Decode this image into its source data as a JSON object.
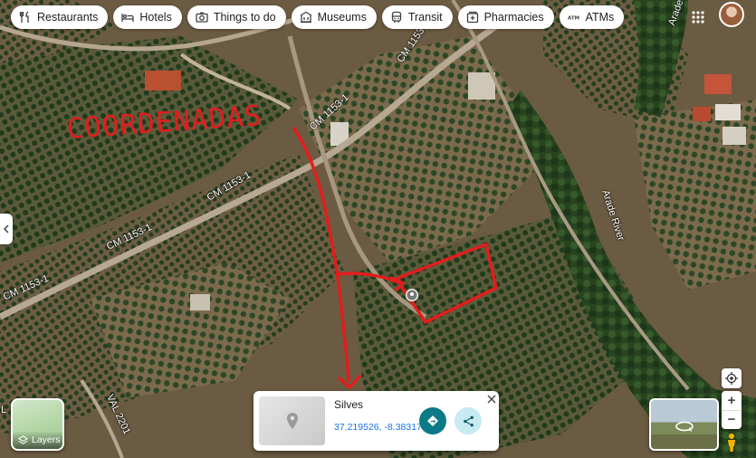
{
  "chips": [
    {
      "icon": "restaurant-icon",
      "label": "Restaurants"
    },
    {
      "icon": "hotel-icon",
      "label": "Hotels"
    },
    {
      "icon": "camera-icon",
      "label": "Things to do"
    },
    {
      "icon": "museum-icon",
      "label": "Museums"
    },
    {
      "icon": "transit-icon",
      "label": "Transit"
    },
    {
      "icon": "pharmacy-icon",
      "label": "Pharmacies"
    },
    {
      "icon": "atm-icon",
      "label": "ATMs"
    }
  ],
  "map_labels": {
    "road_1": "CM 1153-1",
    "road_2": "CM 1153-1",
    "road_3": "CM 1153-1",
    "road_4": "CM 1153-1",
    "road_5": "CM 1153",
    "river": "Arade River",
    "river_top": "Arade",
    "val": "VAL 2201",
    "edge_left": "L"
  },
  "annotation": {
    "handwritten_text": "COORDENADAS",
    "color": "#e21d1d"
  },
  "layers": {
    "label": "Layers"
  },
  "info_card": {
    "place": "Silves",
    "coordinates": "37.219526, -8.383174",
    "directions_color": "#0b7a85",
    "share_color": "#c7eaf3"
  },
  "zoom": {
    "in": "+",
    "out": "−"
  },
  "colors": {
    "chip_bg": "#ffffff",
    "accent_blue": "#1a73e8"
  }
}
